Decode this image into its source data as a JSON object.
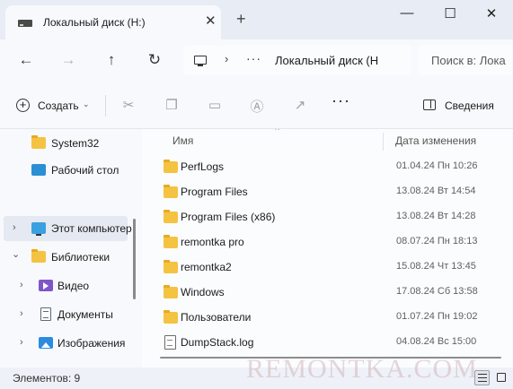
{
  "window": {
    "tab_title": "Локальный диск (H:)",
    "tab_close": "✕",
    "new_tab": "+",
    "minimize": "—",
    "maximize": "☐",
    "close": "✕"
  },
  "navbar": {
    "back": "←",
    "forward": "→",
    "up": "↑",
    "refresh": "↻",
    "address_chevron": "›",
    "address_overflow": "···",
    "address_text": "Локальный диск (H",
    "search_placeholder": "Поиск в: Лока"
  },
  "toolbar": {
    "create_label": "Создать",
    "more": "···",
    "details_label": "Сведения",
    "icons": [
      "cut-icon",
      "copy-icon",
      "paste-icon",
      "rename-icon",
      "share-icon"
    ]
  },
  "sidebar": {
    "items": [
      {
        "label": "System32",
        "icon": "folder-icon",
        "chevron": ""
      },
      {
        "label": "Рабочий стол",
        "icon": "desktop-icon",
        "chevron": ""
      },
      {
        "label": "Этот компьютер",
        "icon": "computer-icon",
        "chevron": "›"
      },
      {
        "label": "Библиотеки",
        "icon": "folder-icon",
        "chevron": "⌄"
      },
      {
        "label": "Видео",
        "icon": "video-icon",
        "chevron": "›"
      },
      {
        "label": "Документы",
        "icon": "documents-icon",
        "chevron": "›"
      },
      {
        "label": "Изображения",
        "icon": "pictures-icon",
        "chevron": "›"
      }
    ]
  },
  "content": {
    "sort_caret": "⌃",
    "columns": {
      "name": "Имя",
      "date": "Дата изменения"
    },
    "rows": [
      {
        "name": "PerfLogs",
        "date": "01.04.24 Пн 10:26",
        "type": "folder"
      },
      {
        "name": "Program Files",
        "date": "13.08.24 Вт 14:54",
        "type": "folder"
      },
      {
        "name": "Program Files (x86)",
        "date": "13.08.24 Вт 14:28",
        "type": "folder"
      },
      {
        "name": "remontka pro",
        "date": "08.07.24 Пн 18:13",
        "type": "folder"
      },
      {
        "name": "remontka2",
        "date": "15.08.24 Чт 13:45",
        "type": "folder"
      },
      {
        "name": "Windows",
        "date": "17.08.24 Сб 13:58",
        "type": "folder"
      },
      {
        "name": "Пользователи",
        "date": "01.07.24 Пн 19:02",
        "type": "folder"
      },
      {
        "name": "DumpStack.log",
        "date": "04.08.24 Вс 15:00",
        "type": "file"
      }
    ]
  },
  "status": {
    "items_count": "Элементов: 9"
  },
  "watermark": "REMONTKA.COM"
}
